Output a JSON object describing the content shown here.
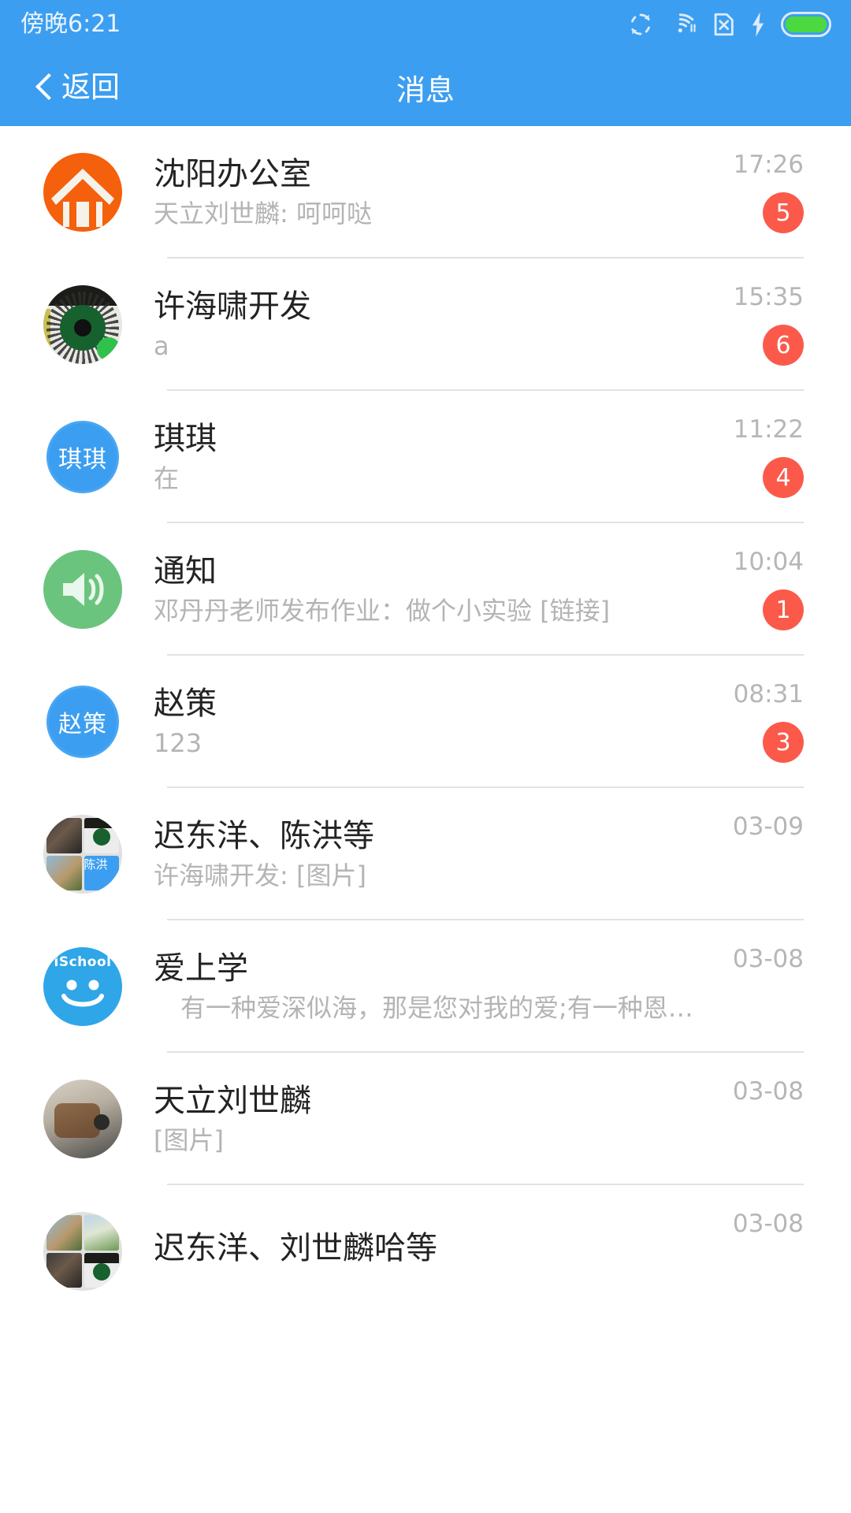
{
  "status_bar": {
    "time": "傍晚6:21",
    "icons": [
      "sync-icon",
      "wifi-icon",
      "sim-card-x-icon",
      "charging-bolt-icon",
      "battery-icon"
    ],
    "battery_color": "#4CD93F",
    "background": "#3C9EF0"
  },
  "nav_bar": {
    "back_label": "返回",
    "title": "消息",
    "background": "#3C9EF0"
  },
  "theme": {
    "accent": "#3C9EF0",
    "badge": "#FB5A4B",
    "title_text": "#232323",
    "preview_text": "#b4b4b4",
    "time_text": "#b6b6b6",
    "divider": "#e2e2e2"
  },
  "chats": [
    {
      "name": "沈阳办公室",
      "preview": "天立刘世麟: 呵呵哒",
      "time": "17:26",
      "badge": "5",
      "avatar_type": "house-icon",
      "avatar_text": "",
      "avatar_color": "#F4600C"
    },
    {
      "name": "许海啸开发",
      "preview": "a",
      "time": "15:35",
      "badge": "6",
      "avatar_type": "photo-qr-avatar",
      "avatar_text": "",
      "avatar_color": "#cfcfc6"
    },
    {
      "name": "琪琪",
      "preview": "在",
      "time": "11:22",
      "badge": "4",
      "avatar_type": "initial-avatar",
      "avatar_text": "琪琪",
      "avatar_color": "#3C9EF0"
    },
    {
      "name": "通知",
      "preview": "邓丹丹老师发布作业：做个小实验 [链接]",
      "time": "10:04",
      "badge": "1",
      "avatar_type": "speaker-icon",
      "avatar_text": "",
      "avatar_color": "#6BC47E"
    },
    {
      "name": "赵策",
      "preview": "123",
      "time": "08:31",
      "badge": "3",
      "avatar_type": "initial-avatar",
      "avatar_text": "赵策",
      "avatar_color": "#3C9EF0"
    },
    {
      "name": "迟东洋、陈洪等",
      "preview": "许海啸开发: [图片]",
      "time": "03-09",
      "badge": "",
      "avatar_type": "group-avatar",
      "avatar_text": "陈洪",
      "avatar_color": "#e0e0e0"
    },
    {
      "name": "爱上学",
      "preview": "有一种爱深似海，那是您对我的爱;有一种恩…",
      "time": "03-08",
      "badge": "",
      "avatar_type": "smiley-ischool-icon",
      "avatar_text": "iSchool",
      "avatar_color": "#2EA6E8"
    },
    {
      "name": "天立刘世麟",
      "preview": "[图片]",
      "time": "03-08",
      "badge": "",
      "avatar_type": "photo-radio-avatar",
      "avatar_text": "",
      "avatar_color": "#8d6a4a"
    },
    {
      "name": "迟东洋、刘世麟哈等",
      "preview": "",
      "time": "03-08",
      "badge": "",
      "avatar_type": "group-avatar-scene",
      "avatar_text": "",
      "avatar_color": "#e0e0e0"
    }
  ]
}
